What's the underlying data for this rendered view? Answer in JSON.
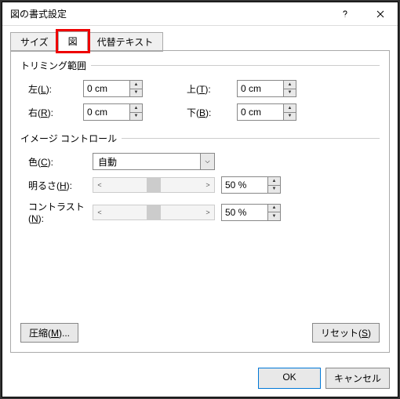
{
  "title": "図の書式設定",
  "tabs": {
    "size": "サイズ",
    "picture": "図",
    "alt": "代替テキスト"
  },
  "trim": {
    "title": "トリミング範囲",
    "left_lbl": "左(",
    "left_u": "L",
    "left_suf": "):",
    "right_lbl": "右(",
    "right_u": "R",
    "right_suf": "):",
    "top_lbl": "上(",
    "top_u": "T",
    "top_suf": "):",
    "bottom_lbl": "下(",
    "bottom_u": "B",
    "bottom_suf": "):",
    "left": "0 cm",
    "right": "0 cm",
    "top": "0 cm",
    "bottom": "0 cm"
  },
  "img": {
    "title": "イメージ コントロール",
    "color_lbl": "色(",
    "color_u": "C",
    "color_suf": "):",
    "bright_lbl": "明るさ(",
    "bright_u": "H",
    "bright_suf": "):",
    "contrast_lbl": "コントラスト(",
    "contrast_u": "N",
    "contrast_suf": "):",
    "color": "自動",
    "brightness": "50 %",
    "contrast": "50 %"
  },
  "buttons": {
    "compress": "圧縮(",
    "compress_u": "M",
    "compress_suf": ")...",
    "reset": "リセット(",
    "reset_u": "S",
    "reset_suf": ")",
    "ok": "OK",
    "cancel": "キャンセル"
  }
}
